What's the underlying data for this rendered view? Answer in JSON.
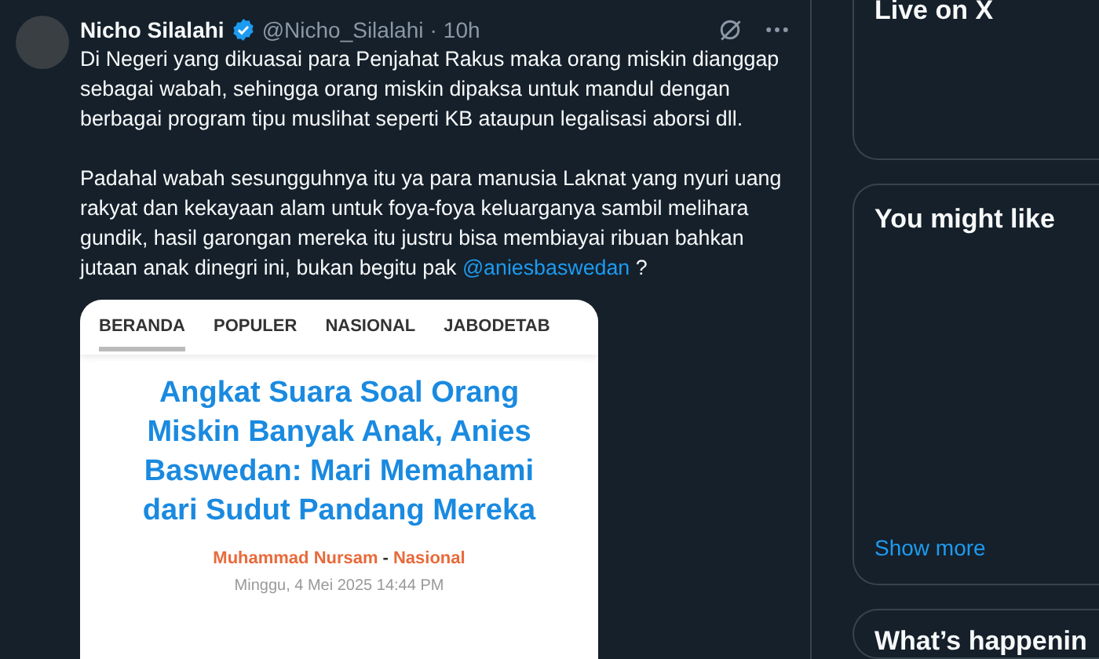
{
  "tweet": {
    "name": "Nicho Silalahi",
    "verified": true,
    "handle": "@Nicho_Silalahi",
    "separator": "·",
    "time": "10h",
    "paragraphs": [
      {
        "text": "Di Negeri yang dikuasai para Penjahat Rakus maka orang miskin dianggap sebagai wabah, sehingga orang miskin dipaksa untuk mandul dengan berbagai program tipu muslihat seperti KB ataupun legalisasi aborsi dll."
      },
      {
        "text": "Padahal wabah sesungguhnya itu ya para manusia Laknat yang nyuri uang rakyat dan kekayaan alam untuk foya-foya keluarganya sambil melihara gundik, hasil garongan mereka itu justru bisa membiayai ribuan bahkan jutaan anak dinegri ini, bukan begitu pak ",
        "mention": "@aniesbaswedan",
        "after": " ?"
      }
    ],
    "media": {
      "tabs": [
        {
          "label": "BERANDA",
          "selected": true
        },
        {
          "label": "POPULER",
          "selected": false
        },
        {
          "label": "NASIONAL",
          "selected": false
        },
        {
          "label": "JABODETAB",
          "selected": false
        }
      ],
      "headline": "Angkat Suara Soal Orang Miskin Banyak Anak, Anies Baswedan: Mari Memahami dari Sudut Pandang Mereka",
      "author": "Muhammad Nursam",
      "dash": "-",
      "category": "Nasional",
      "date": "Minggu, 4 Mei 2025 14:44 PM"
    }
  },
  "sidebar": {
    "live_title": "Live on X",
    "might_like": {
      "title": "You might like",
      "show_more": "Show more"
    },
    "happening_title": "What’s happenin"
  }
}
